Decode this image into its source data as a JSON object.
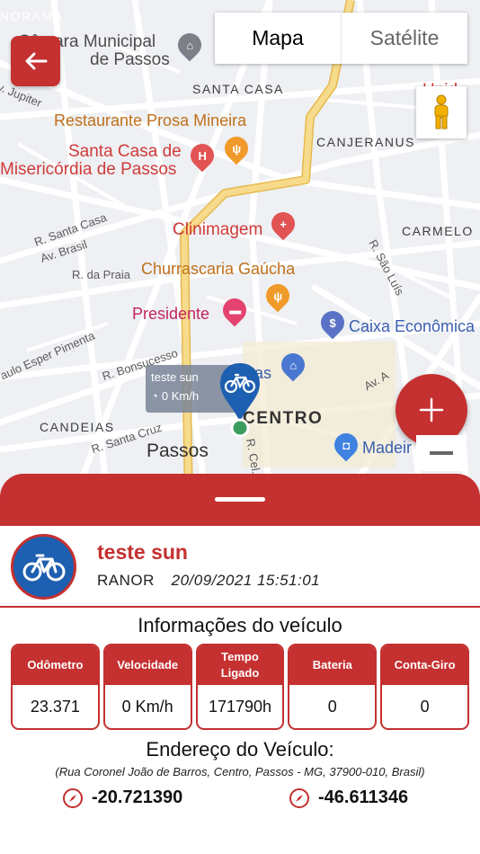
{
  "map": {
    "map_type": {
      "map_label": "Mapa",
      "satellite_label": "Satélite"
    },
    "labels": {
      "panorama": "NORAMA",
      "camara": "Câmara Municipal",
      "camara2": "de Passos",
      "santa_casa_district": "SANTA CASA",
      "restaurante": "Restaurante Prosa Mineira",
      "santa_casa_hospital": "Santa Casa de",
      "misericordia": "Misericórdia de Passos",
      "canjeranus": "CANJERANUS",
      "carmelo": "CARMELO",
      "clinimagem": "Clinimagem",
      "churrascaria": "Churrascaria Gaúcha",
      "presidente": "Presidente",
      "caixa": "Caixa Econômica",
      "centro": "CENTRO",
      "candeias": "CANDEIAS",
      "passos": "Passos",
      "madeir": "Madeir",
      "unidade": "Unid",
      "r_santa_casa": "R. Santa Casa",
      "av_brasil": "Av. Brasil",
      "r_da_praia": "R. da Praia",
      "r_sao_luis": "R. São Luís",
      "paulo_esper": "aulo Esper Pimenta",
      "r_bonsucesso": "R. Bonsucesso",
      "r_santa_cruz": "R. Santa Cruz",
      "v_jupiter": "v. Jupiter",
      "r_cel": "R. Cel.",
      "as": "as",
      "av_a": "Av. A"
    },
    "vehicle_tag": {
      "name": "teste sun",
      "speed": "0 Km/h"
    }
  },
  "vehicle": {
    "name": "teste sun",
    "brand": "RANOR",
    "datetime": "20/09/2021 15:51:01"
  },
  "info": {
    "title": "Informações do veículo",
    "cards": [
      {
        "label": "Odômetro",
        "value": "23.371"
      },
      {
        "label": "Velocidade",
        "value": "0 Km/h"
      },
      {
        "label": "Tempo Ligado",
        "value": "171790h"
      },
      {
        "label": "Bateria",
        "value": "0"
      },
      {
        "label": "Conta-Giro",
        "value": "0"
      }
    ]
  },
  "address": {
    "title": "Endereço do Veículo:",
    "text": "(Rua Coronel João de Barros, Centro, Passos - MG, 37900-010, Brasil)",
    "latitude": "-20.721390",
    "longitude": "-46.611346"
  },
  "colors": {
    "primary": "#c53030",
    "vehicle_blue": "#1d5fb0",
    "highway": "#f3d27a"
  },
  "icons": [
    "back-arrow-icon",
    "pegman-icon",
    "plus-icon",
    "minus-icon",
    "bicycle-icon",
    "compass-icon",
    "hospital-icon",
    "restaurant-icon",
    "hotel-icon",
    "bank-icon",
    "shopping-icon",
    "building-icon",
    "clinic-icon"
  ]
}
